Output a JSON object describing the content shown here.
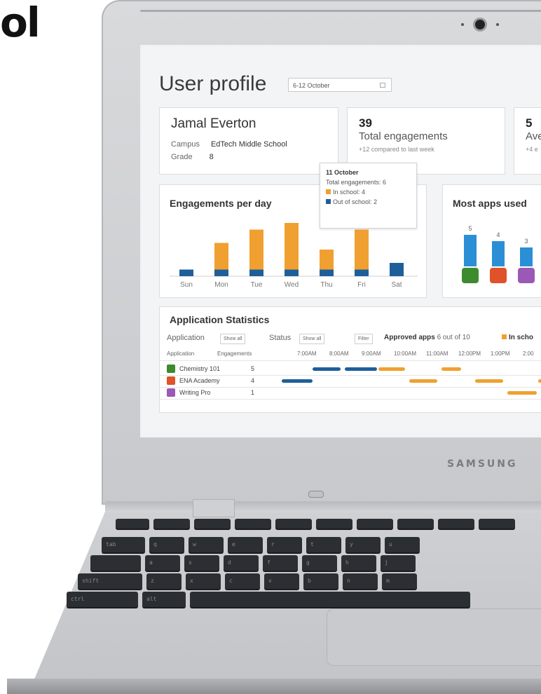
{
  "brand": {
    "text": "ol"
  },
  "laptop": {
    "logo": "SAMSUNG"
  },
  "page": {
    "title": "User profile",
    "date_range": "6-12 October"
  },
  "student": {
    "name": "Jamal Everton",
    "campus_label": "Campus",
    "campus_value": "EdTech Middle School",
    "grade_label": "Grade",
    "grade_value": "8"
  },
  "engagements": {
    "count": "39",
    "label": "Total engagements",
    "compare": "+12 compared to last week"
  },
  "average": {
    "count": "5",
    "label": "Ave",
    "compare": "+4 e"
  },
  "tooltip": {
    "date": "11 October",
    "total": "Total engagements: 6",
    "in_school": "In school: 4",
    "out_school": "Out of school: 2"
  },
  "colors": {
    "in_school": "#f0a030",
    "out_school": "#1f5f99",
    "accent_blue": "#2b8fd6"
  },
  "chart_data": [
    {
      "type": "bar",
      "title": "Engagements per day",
      "categories": [
        "Sun",
        "Mon",
        "Tue",
        "Wed",
        "Thu",
        "Fri",
        "Sat"
      ],
      "series": [
        {
          "name": "In school",
          "values": [
            0,
            4,
            6,
            7,
            3,
            6,
            0
          ]
        },
        {
          "name": "Out of school",
          "values": [
            1,
            1,
            1,
            1,
            1,
            1,
            2
          ]
        }
      ]
    },
    {
      "type": "bar",
      "title": "Most apps used",
      "categories": [
        "Chemistry 101",
        "ENA Academy",
        "Writing Pro"
      ],
      "values": [
        5,
        4,
        3
      ],
      "data_labels": [
        "5",
        "4",
        "3"
      ]
    }
  ],
  "stats": {
    "title": "Application Statistics",
    "application_label": "Application",
    "application_value": "Show all",
    "status_label": "Status",
    "status_value": "Show all",
    "filter_button": "Filter",
    "approved_label": "Approved apps",
    "approved_value": "6 out of 10",
    "legend_in_school": "In scho",
    "columns": [
      "Application",
      "Engagements"
    ],
    "times": [
      "7:00AM",
      "8:00AM",
      "9:00AM",
      "10:00AM",
      "11:00AM",
      "12:00PM",
      "1:00PM",
      "2:00"
    ],
    "rows": [
      {
        "name": "Chemistry 101",
        "engagements": "5",
        "icon": "flask-icon",
        "color": "#3d8b2f"
      },
      {
        "name": "ENA Academy",
        "engagements": "4",
        "icon": "academy-icon",
        "color": "#e0522a"
      },
      {
        "name": "Writing Pro",
        "engagements": "1",
        "icon": "pen-icon",
        "color": "#9b59b6"
      }
    ]
  },
  "keyboard": {
    "row2": [
      "tab",
      "q",
      "w",
      "e",
      "r",
      "t",
      "y",
      "u"
    ],
    "row3": [
      "",
      "a",
      "s",
      "d",
      "f",
      "g",
      "h",
      "j"
    ],
    "row4": [
      "shift",
      "z",
      "x",
      "c",
      "v",
      "b",
      "n",
      "m"
    ],
    "row5": [
      "ctrl",
      "alt"
    ]
  }
}
